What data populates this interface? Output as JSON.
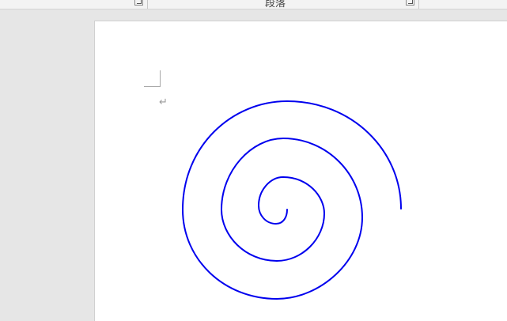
{
  "ribbon": {
    "group_label": "段落"
  },
  "document": {
    "paragraph_mark": "↵"
  },
  "shape": {
    "type": "spiral",
    "stroke_color": "#0000ee"
  }
}
